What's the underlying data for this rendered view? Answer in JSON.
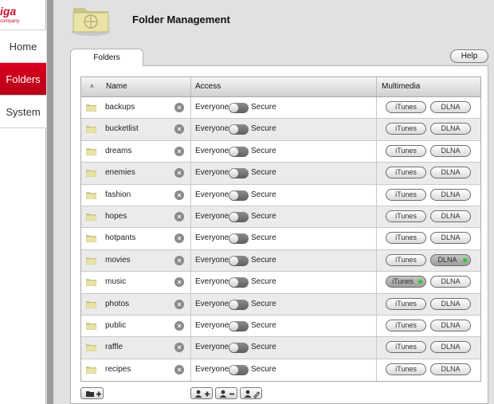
{
  "sidebar": {
    "logo_text": "iga",
    "logo_subtext": "company",
    "items": [
      {
        "label": "Home"
      },
      {
        "label": "Folders"
      },
      {
        "label": "System"
      }
    ]
  },
  "header": {
    "title": "Folder Management"
  },
  "tabs": [
    {
      "label": "Folders"
    }
  ],
  "help_label": "Help",
  "table": {
    "sort_indicator": "˄",
    "columns": {
      "name": "Name",
      "access": "Access",
      "multimedia": "Multimedia"
    },
    "access_everyone_label": "Everyone",
    "access_secure_label": "Secure",
    "itunes_label": "iTunes",
    "dlna_label": "DLNA",
    "rows": [
      {
        "name": "backups",
        "itunes_on": false,
        "dlna_on": false
      },
      {
        "name": "bucketlist",
        "itunes_on": false,
        "dlna_on": false
      },
      {
        "name": "dreams",
        "itunes_on": false,
        "dlna_on": false
      },
      {
        "name": "enemies",
        "itunes_on": false,
        "dlna_on": false
      },
      {
        "name": "fashion",
        "itunes_on": false,
        "dlna_on": false
      },
      {
        "name": "hopes",
        "itunes_on": false,
        "dlna_on": false
      },
      {
        "name": "hotpants",
        "itunes_on": false,
        "dlna_on": false
      },
      {
        "name": "movies",
        "itunes_on": false,
        "dlna_on": true
      },
      {
        "name": "music",
        "itunes_on": true,
        "dlna_on": false
      },
      {
        "name": "photos",
        "itunes_on": false,
        "dlna_on": false
      },
      {
        "name": "public",
        "itunes_on": false,
        "dlna_on": false
      },
      {
        "name": "raffle",
        "itunes_on": false,
        "dlna_on": false
      },
      {
        "name": "recipes",
        "itunes_on": false,
        "dlna_on": false
      }
    ]
  },
  "colors": {
    "accent_red": "#c8102e",
    "enabled_indicator": "#37c23a",
    "folder_icon": "#e9e3a6"
  },
  "icons": {
    "header": "folder-share-icon",
    "row": "folder-icon",
    "remove": "remove-circle-icon",
    "bottom": [
      "add-folder-icon",
      "add-user-icon",
      "remove-user-icon",
      "edit-user-icon"
    ]
  }
}
